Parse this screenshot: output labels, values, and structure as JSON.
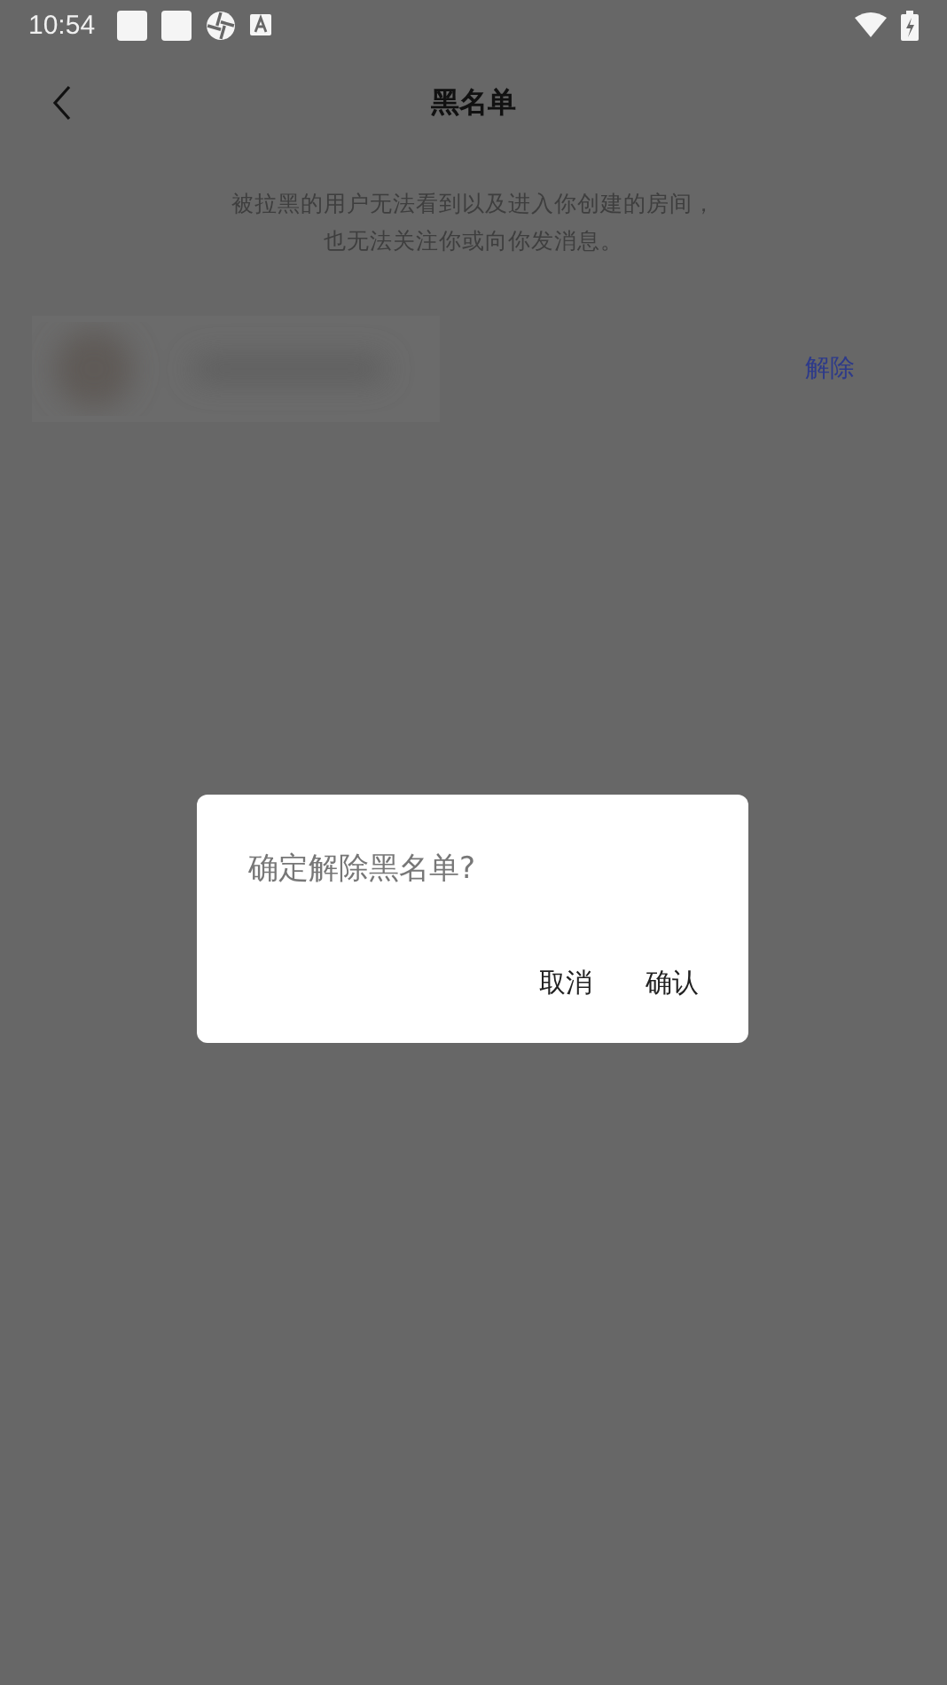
{
  "status_bar": {
    "time": "10:54"
  },
  "header": {
    "title": "黑名单"
  },
  "description_lines": [
    "被拉黑的用户无法看到以及进入你创建的房间，",
    "也无法关注你或向你发消息。"
  ],
  "blocked_users": [
    {
      "action": "解除"
    }
  ],
  "dialog": {
    "message": "确定解除黑名单?",
    "buttons": [
      "取消",
      "确认"
    ]
  }
}
